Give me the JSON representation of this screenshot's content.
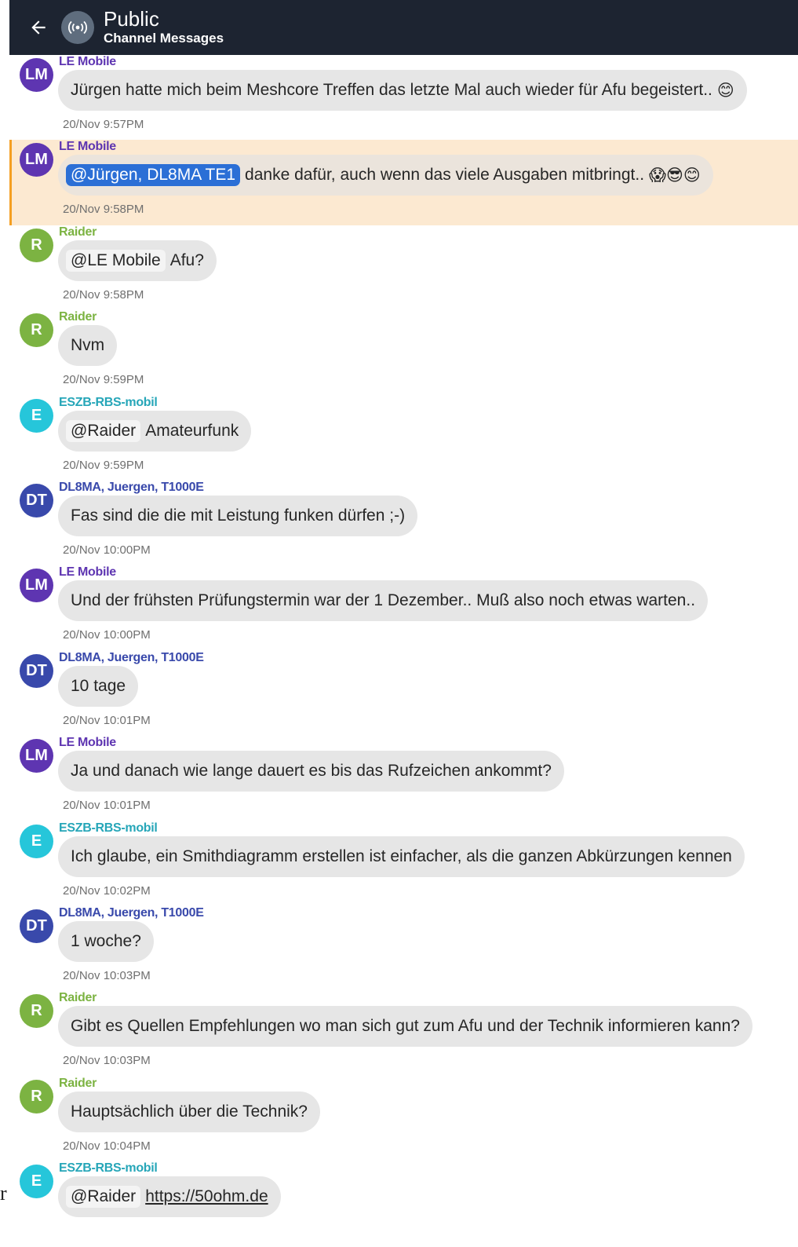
{
  "header": {
    "title": "Public",
    "subtitle": "Channel Messages",
    "back_icon": "arrow-left-icon",
    "channel_icon": "broadcast-icon",
    "bg_color": "#1d2431"
  },
  "stray_text": "r",
  "messages": [
    {
      "sender": "LE Mobile",
      "initials": "LM",
      "color": "#5e35b1",
      "name_color": "#5e35b1",
      "mention": "",
      "text": "Jürgen hatte mich beim Meshcore Treffen das letzte Mal auch wieder für Afu begeistert..",
      "emoji": "😊",
      "time": "20/Nov 9:57PM",
      "highlight": false
    },
    {
      "sender": "LE Mobile",
      "initials": "LM",
      "color": "#5e35b1",
      "name_color": "#5e35b1",
      "mention": "@Jürgen, DL8MA TE1",
      "text": "danke dafür, auch wenn das viele Ausgaben mitbringt..",
      "emoji": "😱😎😊",
      "time": "20/Nov 9:58PM",
      "highlight": true
    },
    {
      "sender": "Raider",
      "initials": "R",
      "color": "#7cb342",
      "name_color": "#7cb342",
      "mention": "@LE Mobile",
      "text": "Afu?",
      "emoji": "",
      "time": "20/Nov 9:58PM",
      "highlight": false
    },
    {
      "sender": "Raider",
      "initials": "R",
      "color": "#7cb342",
      "name_color": "#7cb342",
      "mention": "",
      "text": "Nvm",
      "emoji": "",
      "time": "20/Nov 9:59PM",
      "highlight": false
    },
    {
      "sender": "ESZB-RBS-mobil",
      "initials": "E",
      "color": "#26c6da",
      "name_color": "#26a6b8",
      "mention": "@Raider",
      "text": "Amateurfunk",
      "emoji": "",
      "time": "20/Nov 9:59PM",
      "highlight": false
    },
    {
      "sender": "DL8MA, Juergen, T1000E",
      "initials": "DT",
      "color": "#3949ab",
      "name_color": "#3949ab",
      "mention": "",
      "text": "Fas sind die die mit Leistung funken dürfen ;-)",
      "emoji": "",
      "time": "20/Nov 10:00PM",
      "highlight": false
    },
    {
      "sender": "LE Mobile",
      "initials": "LM",
      "color": "#5e35b1",
      "name_color": "#5e35b1",
      "mention": "",
      "text": "Und der frühsten Prüfungstermin war der 1 Dezember.. Muß also noch etwas warten..",
      "emoji": "",
      "time": "20/Nov 10:00PM",
      "highlight": false
    },
    {
      "sender": "DL8MA, Juergen, T1000E",
      "initials": "DT",
      "color": "#3949ab",
      "name_color": "#3949ab",
      "mention": "",
      "text": "10 tage",
      "emoji": "",
      "time": "20/Nov 10:01PM",
      "highlight": false
    },
    {
      "sender": "LE Mobile",
      "initials": "LM",
      "color": "#5e35b1",
      "name_color": "#5e35b1",
      "mention": "",
      "text": "Ja und danach wie lange dauert es bis das Rufzeichen ankommt?",
      "emoji": "",
      "time": "20/Nov 10:01PM",
      "highlight": false
    },
    {
      "sender": "ESZB-RBS-mobil",
      "initials": "E",
      "color": "#26c6da",
      "name_color": "#26a6b8",
      "mention": "",
      "text": "Ich glaube, ein Smithdiagramm erstellen ist einfacher, als die ganzen Abkürzungen kennen",
      "emoji": "",
      "time": "20/Nov 10:02PM",
      "highlight": false
    },
    {
      "sender": "DL8MA, Juergen, T1000E",
      "initials": "DT",
      "color": "#3949ab",
      "name_color": "#3949ab",
      "mention": "",
      "text": "1 woche?",
      "emoji": "",
      "time": "20/Nov 10:03PM",
      "highlight": false
    },
    {
      "sender": "Raider",
      "initials": "R",
      "color": "#7cb342",
      "name_color": "#7cb342",
      "mention": "",
      "text": "Gibt es Quellen Empfehlungen wo man sich gut zum Afu und der Technik informieren kann?",
      "emoji": "",
      "time": "20/Nov 10:03PM",
      "highlight": false
    },
    {
      "sender": "Raider",
      "initials": "R",
      "color": "#7cb342",
      "name_color": "#7cb342",
      "mention": "",
      "text": "Hauptsächlich über die Technik?",
      "emoji": "",
      "time": "20/Nov 10:04PM",
      "highlight": false
    },
    {
      "sender": "ESZB-RBS-mobil",
      "initials": "E",
      "color": "#26c6da",
      "name_color": "#26a6b8",
      "mention": "@Raider",
      "text": "https://50ohm.de",
      "is_link": true,
      "emoji": "",
      "time": "",
      "highlight": false
    }
  ]
}
